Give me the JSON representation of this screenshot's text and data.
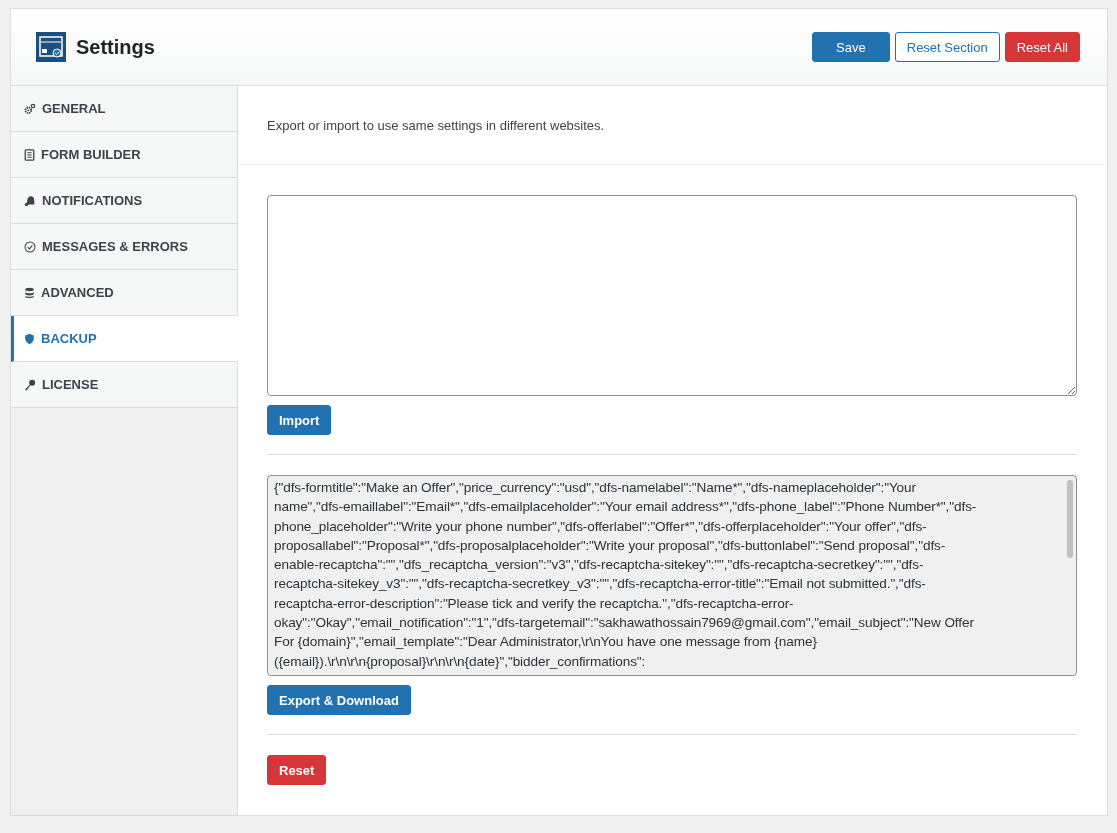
{
  "header": {
    "title": "Settings",
    "buttons": [
      {
        "label": "Save",
        "kind": "primary"
      },
      {
        "label": "Reset Section",
        "kind": "outline"
      },
      {
        "label": "Reset All",
        "kind": "danger"
      }
    ]
  },
  "sidebar": {
    "items": [
      {
        "label": "GENERAL",
        "selected": false
      },
      {
        "label": "FORM BUILDER",
        "selected": false
      },
      {
        "label": "NOTIFICATIONS",
        "selected": false
      },
      {
        "label": "MESSAGES & ERRORS",
        "selected": false
      },
      {
        "label": "ADVANCED",
        "selected": false
      },
      {
        "label": "BACKUP",
        "selected": true
      },
      {
        "label": "LICENSE",
        "selected": false
      }
    ]
  },
  "content": {
    "description": "Export or import to use same settings in different websites.",
    "import": {
      "button": "Import"
    },
    "export": {
      "lines": [
        "{\"dfs-formtitle\":\"Make an Offer\",\"price_currency\":\"usd\",\"dfs-namelabel\":\"Name*\",\"dfs-nameplaceholder\":\"Your",
        "name\",\"dfs-emaillabel\":\"Email*\",\"dfs-emailplaceholder\":\"Your email address*\",\"dfs-phone_label\":\"Phone Number*\",\"dfs-",
        "phone_placeholder\":\"Write your phone number\",\"dfs-offerlabel\":\"Offer*\",\"dfs-offerplaceholder\":\"Your offer\",\"dfs-",
        "proposallabel\":\"Proposal*\",\"dfs-proposalplaceholder\":\"Write your proposal\",\"dfs-buttonlabel\":\"Send proposal\",\"dfs-",
        "enable-recaptcha\":\"\",\"dfs_recaptcha_version\":\"v3\",\"dfs-recaptcha-sitekey\":\"\",\"dfs-recaptcha-secretkey\":\"\",\"dfs-",
        "recaptcha-sitekey_v3\":\"\",\"dfs-recaptcha-secretkey_v3\":\"\",\"dfs-recaptcha-error-title\":\"Email not submitted.\",\"dfs-",
        "recaptcha-error-description\":\"Please tick and verify the recaptcha.\",\"dfs-recaptcha-error-",
        "okay\":\"Okay\",\"email_notification\":\"1\",\"dfs-targetemail\":\"sakhawathossain7969@gmail.com\",\"email_subject\":\"New Offer",
        "For {domain}\",\"email_template\":\"Dear Administrator,\\r\\nYou have one message from {name}",
        "({email}).\\r\\n\\r\\n{proposal}\\r\\n\\r\\n{date}\",\"bidder_confirmations\":"
      ],
      "button": "Export & Download"
    },
    "reset": {
      "button": "Reset"
    }
  }
}
